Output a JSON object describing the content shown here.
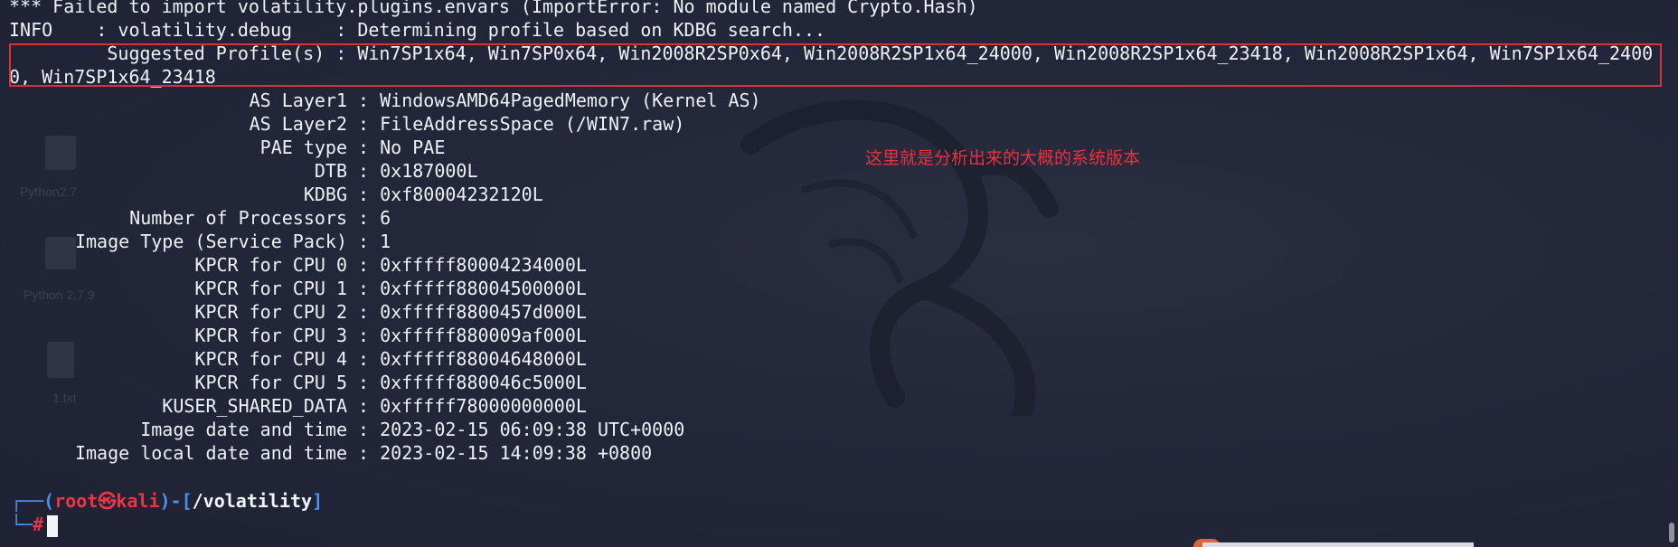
{
  "terminal": {
    "header_lines": [
      "*** Failed to import volatility.plugins.envars (ImportError: No module named Crypto.Hash)",
      "INFO    : volatility.debug    : Determining profile based on KDBG search..."
    ],
    "suggested_line1": "         Suggested Profile(s) : Win7SP1x64, Win7SP0x64, Win2008R2SP0x64, Win2008R2SP1x64_24000, Win2008R2SP1x64_23418, Win2008R2SP1x64, Win7SP1x64_2400",
    "suggested_line2": "0, Win7SP1x64_23418",
    "rows": [
      {
        "label": "AS Layer1",
        "value": "WindowsAMD64PagedMemory (Kernel AS)"
      },
      {
        "label": "AS Layer2",
        "value": "FileAddressSpace (/WIN7.raw)"
      },
      {
        "label": "PAE type",
        "value": "No PAE"
      },
      {
        "label": "DTB",
        "value": "0x187000L"
      },
      {
        "label": "KDBG",
        "value": "0xf80004232120L"
      },
      {
        "label": "Number of Processors",
        "value": "6"
      },
      {
        "label": "Image Type (Service Pack)",
        "value": "1"
      },
      {
        "label": "KPCR for CPU 0",
        "value": "0xfffff80004234000L"
      },
      {
        "label": "KPCR for CPU 1",
        "value": "0xfffff88004500000L"
      },
      {
        "label": "KPCR for CPU 2",
        "value": "0xfffff8800457d000L"
      },
      {
        "label": "KPCR for CPU 3",
        "value": "0xfffff880009af000L"
      },
      {
        "label": "KPCR for CPU 4",
        "value": "0xfffff88004648000L"
      },
      {
        "label": "KPCR for CPU 5",
        "value": "0xfffff880046c5000L"
      },
      {
        "label": "KUSER_SHARED_DATA",
        "value": "0xfffff78000000000L"
      },
      {
        "label": "Image date and time",
        "value": "2023-02-15 06:09:38 UTC+0000"
      },
      {
        "label": "Image local date and time",
        "value": "2023-02-15 14:09:38 +0800"
      }
    ],
    "separator": " : ",
    "annotation": "这里就是分析出来的大概的系统版本",
    "prompt": {
      "corner_top": "┌──(",
      "user": "root",
      "at_symbol": "㉿",
      "host": "kali",
      "mid": ")-[",
      "path": "/volatility",
      "close": "]",
      "corner_bottom": "└─",
      "hash": "#"
    },
    "desktop_ghosts": [
      "Python2.7",
      "Python 2.7.9",
      "1.txt"
    ]
  },
  "colors": {
    "background": "#23273a",
    "text": "#eef0f4",
    "highlight_border": "#d9303a",
    "annotation": "#e8303e",
    "prompt_blue": "#4b8ff0",
    "prompt_red": "#ea3545"
  }
}
